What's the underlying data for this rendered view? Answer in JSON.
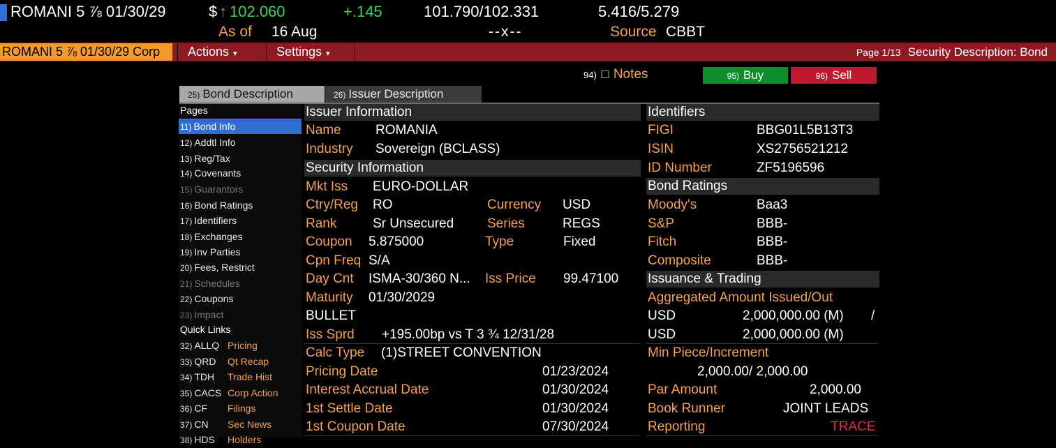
{
  "quote": {
    "ticker": "ROMANI 5 ⅞ 01/30/29",
    "currency_symbol": "$",
    "arrow": "↑",
    "price": "102.060",
    "change": "+.145",
    "bid_ask": "101.790/102.331",
    "yields": "5.416/5.279",
    "as_of_label": "As of",
    "as_of_date": "16 Aug",
    "size": "--x--",
    "source_label": "Source",
    "source_value": "CBBT"
  },
  "toolbar": {
    "security_box": "ROMANI 5 ⅞ 01/30/29 Corp",
    "actions": "Actions",
    "settings": "Settings",
    "page": "Page 1/13",
    "title": "Security Description: Bond"
  },
  "action_buttons": {
    "notes_num": "94)",
    "notes": "Notes",
    "buy_num": "95)",
    "buy": "Buy",
    "sell_num": "96)",
    "sell": "Sell"
  },
  "tabs": [
    {
      "num": "25)",
      "label": "Bond Description"
    },
    {
      "num": "26)",
      "label": "Issuer Description"
    }
  ],
  "sidebar": {
    "pages_header": "Pages",
    "items": [
      {
        "num": "11)",
        "label": "Bond Info"
      },
      {
        "num": "12)",
        "label": "Addtl Info"
      },
      {
        "num": "13)",
        "label": "Reg/Tax"
      },
      {
        "num": "14)",
        "label": "Covenants"
      },
      {
        "num": "15)",
        "label": "Guarantors"
      },
      {
        "num": "16)",
        "label": "Bond Ratings"
      },
      {
        "num": "17)",
        "label": "Identifiers"
      },
      {
        "num": "18)",
        "label": "Exchanges"
      },
      {
        "num": "19)",
        "label": "Inv Parties"
      },
      {
        "num": "20)",
        "label": "Fees, Restrict"
      },
      {
        "num": "21)",
        "label": "Schedules"
      },
      {
        "num": "22)",
        "label": "Coupons"
      },
      {
        "num": "23)",
        "label": "Impact"
      }
    ],
    "quick_links_header": "Quick Links",
    "quick_links": [
      {
        "num": "32)",
        "code": "ALLQ",
        "label": "Pricing"
      },
      {
        "num": "33)",
        "code": "QRD",
        "label": "Qt Recap"
      },
      {
        "num": "34)",
        "code": "TDH",
        "label": "Trade Hist"
      },
      {
        "num": "35)",
        "code": "CACS",
        "label": "Corp Action"
      },
      {
        "num": "36)",
        "code": "CF",
        "label": "Filings"
      },
      {
        "num": "37)",
        "code": "CN",
        "label": "Sec News"
      },
      {
        "num": "38)",
        "code": "HDS",
        "label": "Holders"
      }
    ]
  },
  "issuer": {
    "header": "Issuer Information",
    "name_label": "Name",
    "name": "ROMANIA",
    "industry_label": "Industry",
    "industry": "Sovereign (BCLASS)"
  },
  "security": {
    "header": "Security Information",
    "mkt_iss_label": "Mkt Iss",
    "mkt_iss": "EURO-DOLLAR",
    "ctry_label": "Ctry/Reg",
    "ctry": "RO",
    "currency_label": "Currency",
    "currency": "USD",
    "rank_label": "Rank",
    "rank": "Sr Unsecured",
    "series_label": "Series",
    "series": "REGS",
    "coupon_label": "Coupon",
    "coupon": "5.875000",
    "type_label": "Type",
    "type": "Fixed",
    "cpn_freq_label": "Cpn Freq",
    "cpn_freq": "S/A",
    "day_cnt_label": "Day Cnt",
    "day_cnt": "ISMA-30/360 N...",
    "iss_price_label": "Iss Price",
    "iss_price": "99.47100",
    "maturity_label": "Maturity",
    "maturity": "01/30/2029",
    "bullet": "BULLET",
    "iss_sprd_label": "Iss Sprd",
    "iss_sprd": "+195.00bp vs T 3 ¾ 12/31/28",
    "calc_type_label": "Calc Type",
    "calc_type": "(1)STREET CONVENTION",
    "pricing_date_label": "Pricing Date",
    "pricing_date": "01/23/2024",
    "interest_accrual_label": "Interest Accrual Date",
    "interest_accrual": "01/30/2024",
    "first_settle_label": "1st Settle Date",
    "first_settle": "01/30/2024",
    "first_coupon_label": "1st Coupon Date",
    "first_coupon": "07/30/2024"
  },
  "identifiers": {
    "header": "Identifiers",
    "figi_label": "FIGI",
    "figi": "BBG01L5B13T3",
    "isin_label": "ISIN",
    "isin": "XS2756521212",
    "id_label": "ID Number",
    "id": "ZF5196596"
  },
  "ratings": {
    "header": "Bond Ratings",
    "moodys_label": "Moody's",
    "moodys": "Baa3",
    "sp_label": "S&P",
    "sp": "BBB-",
    "fitch_label": "Fitch",
    "fitch": "BBB-",
    "composite_label": "Composite",
    "composite": "BBB-"
  },
  "issuance": {
    "header": "Issuance & Trading",
    "agg_label": "Aggregated Amount Issued/Out",
    "issued_ccy": "USD",
    "issued_amt": "2,000,000.00 (M)",
    "slash": "/",
    "out_ccy": "USD",
    "out_amt": "2,000,000.00 (M)",
    "min_piece_label": "Min Piece/Increment",
    "min_piece": "2,000.00/ 2,000.00",
    "par_label": "Par Amount",
    "par": "2,000.00",
    "book_runner_label": "Book Runner",
    "book_runner": "JOINT LEADS",
    "reporting_label": "Reporting",
    "reporting": "TRACE"
  },
  "colors": {
    "label_orange": "#f5a24b",
    "header_red": "#8b1a22",
    "buy_green": "#0f8f2b",
    "sell_red": "#c0182f",
    "price_green": "#3cd35a",
    "active_blue": "#2f6fcf"
  }
}
